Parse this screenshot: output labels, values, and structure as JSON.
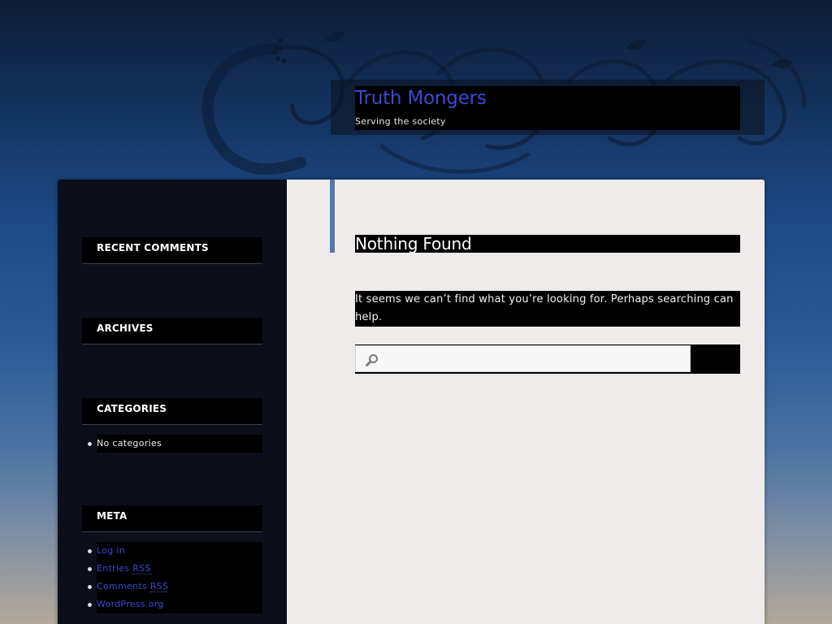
{
  "site": {
    "title": "Truth Mongers",
    "tagline": "Serving the society"
  },
  "sidebar": {
    "recent_comments": {
      "title": "RECENT COMMENTS"
    },
    "archives": {
      "title": "ARCHIVES"
    },
    "categories": {
      "title": "CATEGORIES",
      "items": [
        "No categories"
      ]
    },
    "meta": {
      "title": "META",
      "log_in": "Log in",
      "entries_prefix": "Entries ",
      "entries_abbr": "RSS",
      "comments_prefix": "Comments ",
      "comments_abbr": "RSS",
      "wordpress": "WordPress.org"
    }
  },
  "main": {
    "heading": "Nothing Found",
    "message": "It seems we can’t find what you’re looking for. Perhaps searching can help.",
    "search": {
      "placeholder": "",
      "value": "",
      "submit_label": ""
    }
  },
  "colors": {
    "link": "#3a4bd6",
    "accent": "#5279ac",
    "sidebar_bg": "#0c0f1a",
    "content_bg": "#eeebea"
  },
  "icons": {
    "search": "magnifier-icon"
  }
}
